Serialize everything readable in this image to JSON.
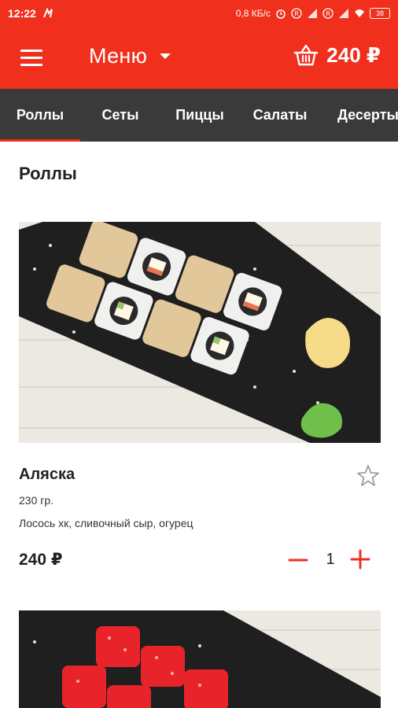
{
  "status": {
    "time": "12:22",
    "speed": "0,8 КБ/с",
    "battery": "38"
  },
  "appbar": {
    "title": "Меню",
    "cart_total": "240 ₽"
  },
  "tabs": [
    "Роллы",
    "Сеты",
    "Пиццы",
    "Салаты",
    "Десерты"
  ],
  "active_tab": 0,
  "section_title": "Роллы",
  "product": {
    "name": "Аляска",
    "weight": "230 гр.",
    "description": "Лосось хк, сливочный сыр, огурец",
    "price": "240 ₽",
    "quantity": "1"
  },
  "colors": {
    "brand_red": "#f0301d",
    "tab_bar": "#3a3a3a"
  },
  "icons": {
    "menu": "hamburger-icon",
    "cart": "basket-icon",
    "favorite": "star-outline-icon",
    "decrease": "minus-icon",
    "increase": "plus-icon"
  }
}
